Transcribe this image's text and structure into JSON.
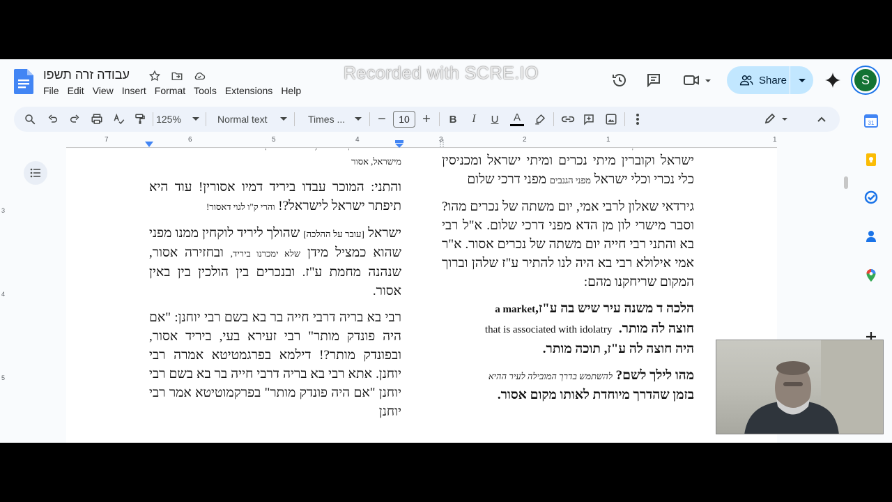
{
  "header": {
    "doc_title": "עבודה זרה תשפו",
    "watermark": "Recorded with SCRE.IO",
    "share_label": "Share",
    "avatar_letter": "S",
    "menu": [
      "File",
      "Edit",
      "View",
      "Insert",
      "Format",
      "Tools",
      "Extensions",
      "Help"
    ]
  },
  "toolbar": {
    "zoom": "125%",
    "style": "Normal text",
    "font": "Times ...",
    "font_size": "10",
    "bold": "B",
    "italic": "I",
    "underline": "U",
    "text_color_letter": "A"
  },
  "ruler": {
    "numbers": [
      "7",
      "6",
      "5",
      "4",
      "3",
      "2",
      "1",
      "1"
    ]
  },
  "vruler": {
    "numbers": [
      "3",
      "4",
      "5"
    ]
  },
  "left_column": [
    {
      "text": "מישראל, אסור",
      "cls": "small"
    },
    {
      "text": "והתני: המוכר עבדו ביריד דמיו אסורין! עוד היא תיפתר ישראל לישראל?!",
      "tail": "והרי ק\"ו לגוי דאסור!"
    },
    {
      "text": "ישראל",
      "mid": "[עובר על ההלכה]",
      "text2": "שהולך ליריד לוקחין ממנו מפני שהוא כמציל מידן",
      "mid2": "שלא ימכרנו ביריד,",
      "text3": "ובחזירה אסור, שנהנה מחמת ע\"ז. ובנכרים בין הולכין בין באין אסור."
    },
    {
      "text": "רבי בא בריה דרבי חייה בר בא בשם רבי יוחנן: \"אם היה פונדק מותר\" רבי זעירא בעי, ביריד אסור, ובפונדק מותר?! דילמא בפרגמטיטא אמרה רבי יוחנן. אתא רבי בא בריה דרבי חייה בר בא בשם רבי יוחנן \"אם היה פונדק מותר\" בפרקמוטיטא אמר רבי יוחנן"
    }
  ],
  "right_column": [
    {
      "text": "ישראל וקוברין מיתי נכרים ומיתי ישראל ומכניסין כלי נכרי וכלי ישראל",
      "small": "מפני הגנבים",
      "text2": "מפני דרכי שלום"
    },
    {
      "text": "גירדאי שאלון לרבי אמי, יום משתה של נכרים מהו? וסבר מישרי לון מן הדא מפני דרכי שלום. א\"ל רבי בא והתני רבי חייה יום משתה של נכרים אסור. א\"ר אמי אילולא רבי בא היה לנו להתיר ע\"ז שלהן וברוך המקום שריחקנו מהם:"
    },
    {
      "text": "הלכה ד משנה עיר שיש בה ע\"ז,",
      "en": "a market",
      "cls": "bold"
    },
    {
      "text": "חוצה לה מותר.",
      "en": "that is associated with idolatry",
      "cls": "bold"
    },
    {
      "text": "היה חוצה לה ע\"ז, תוכה מותר.",
      "cls": "bold"
    },
    {
      "text": "מהו לילך לשם?",
      "small": "להשתמש בדרך המובילה לעיר ההיא",
      "cls": "bold"
    },
    {
      "text": "בזמן שהדרך מיוחדת לאותו מקום אסור.",
      "cls": "bold"
    }
  ],
  "colors": {
    "accent": "#1a73e8",
    "share_bg": "#c2e7ff",
    "toolbar_bg": "#edf2fa",
    "avatar": "#137333"
  }
}
